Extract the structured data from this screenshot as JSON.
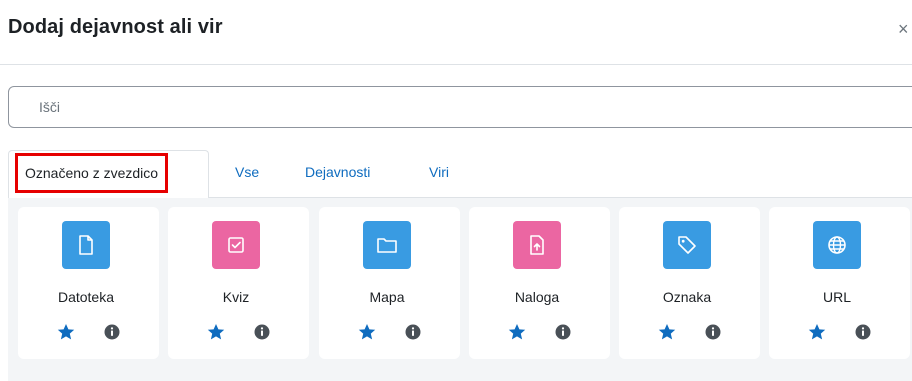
{
  "dialog": {
    "title": "Dodaj dejavnost ali vir",
    "close": "×"
  },
  "search": {
    "placeholder": "Išči"
  },
  "tabs": [
    {
      "label": "Označeno z zvezdico"
    },
    {
      "label": "Vse"
    },
    {
      "label": "Dejavnosti"
    },
    {
      "label": "Viri"
    }
  ],
  "activities": [
    {
      "name": "Datoteka",
      "icon": "file-icon",
      "color": "#399be2"
    },
    {
      "name": "Kviz",
      "icon": "quiz-checkbox-icon",
      "color": "#eb66a2"
    },
    {
      "name": "Mapa",
      "icon": "folder-icon",
      "color": "#399be2"
    },
    {
      "name": "Naloga",
      "icon": "assignment-upload-icon",
      "color": "#eb66a2"
    },
    {
      "name": "Oznaka",
      "icon": "tag-icon",
      "color": "#399be2"
    },
    {
      "name": "URL",
      "icon": "globe-icon",
      "color": "#399be2"
    }
  ],
  "colors": {
    "link": "#0f6cbf",
    "star": "#0f6cbf",
    "highlight": "#e60000"
  }
}
